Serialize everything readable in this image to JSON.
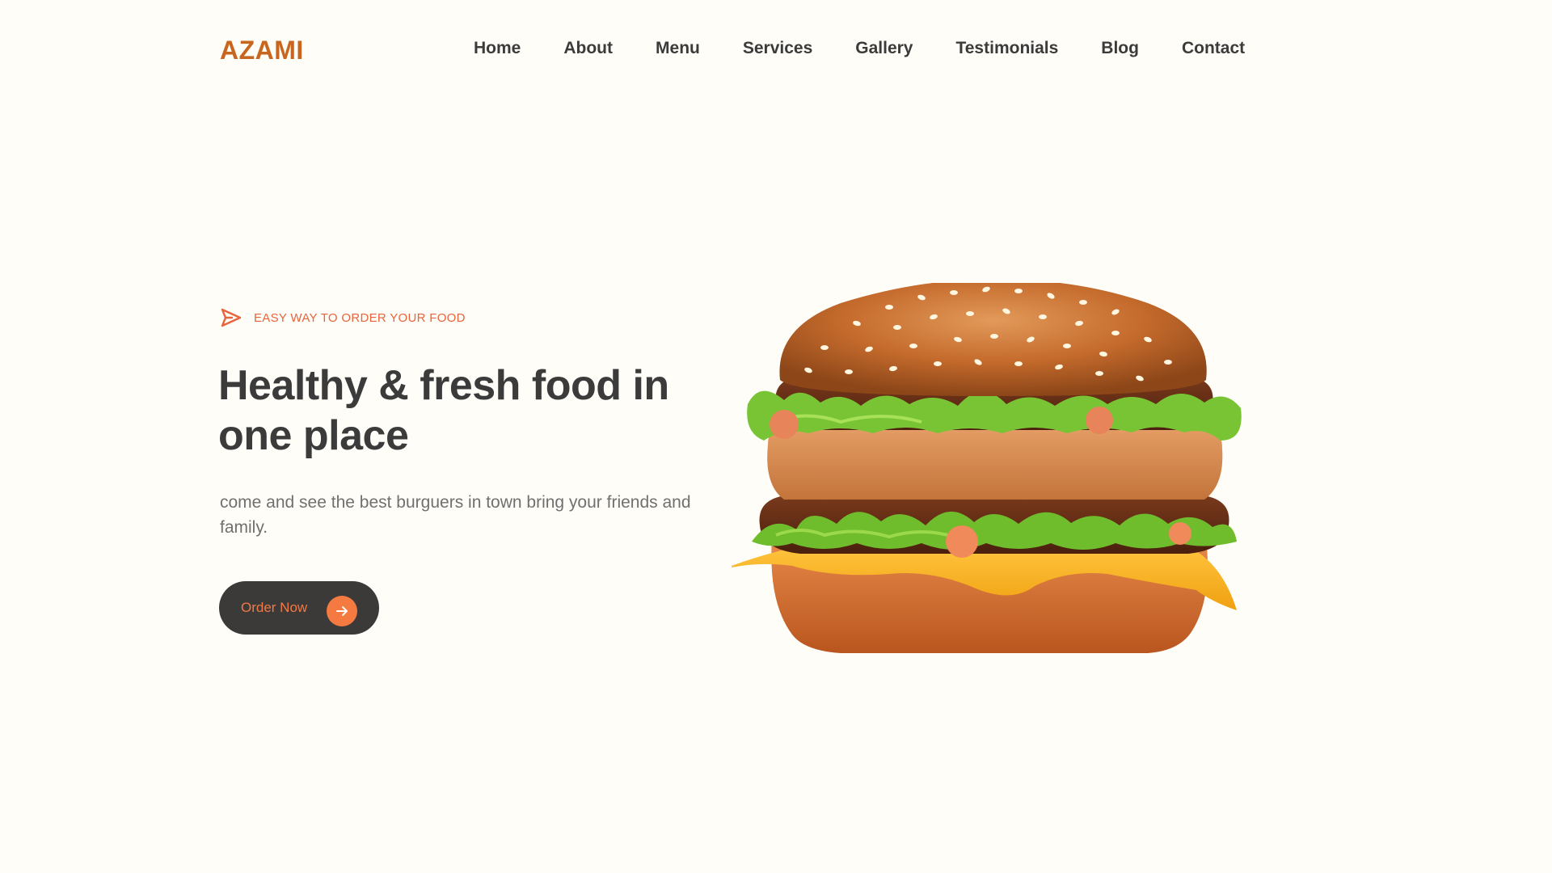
{
  "header": {
    "logo": "AZAMI",
    "nav": [
      "Home",
      "About",
      "Menu",
      "Services",
      "Gallery",
      "Testimonials",
      "Blog",
      "Contact"
    ]
  },
  "hero": {
    "tagline": "EASY WAY TO ORDER YOUR FOOD",
    "title": "Healthy & fresh food in one place",
    "description": "come and see the best burguers in town bring your friends and family.",
    "cta_label": "Order Now",
    "tagline_icon": "paper-plane-icon",
    "cta_icon": "arrow-right-icon"
  },
  "colors": {
    "background": "#fffdf7",
    "brand": "#c8651e",
    "accent": "#f47a42",
    "text_dark": "#3b3b3b",
    "text_muted": "#707070",
    "button_bg": "#3c3a39"
  }
}
